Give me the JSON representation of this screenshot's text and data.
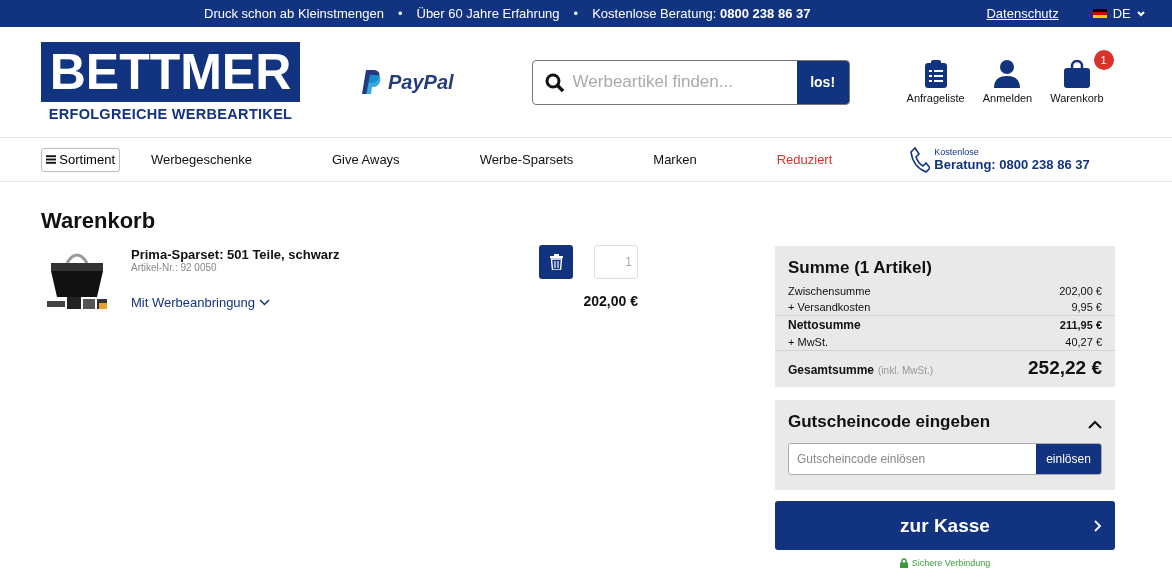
{
  "top_bar": {
    "items": [
      "Druck schon ab Kleinstmengen",
      "Über 60 Jahre Erfahrung",
      "Kostenlose Beratung: **0800 238 86 37**"
    ],
    "separator": "•",
    "link": "Datenschutz",
    "language": "DE"
  },
  "header": {
    "logo": {
      "name": "BETTMER",
      "tagline": "ERFOLGREICHE WERBEARTIKEL"
    },
    "payment": "PayPal",
    "search": {
      "placeholder": "Werbeartikel finden...",
      "button": "los!"
    },
    "actions": [
      {
        "kind": "list",
        "label": "Anfrageliste"
      },
      {
        "kind": "user",
        "label": "Anmelden"
      },
      {
        "kind": "cart",
        "label": "Warenkorb",
        "badge": "1"
      }
    ]
  },
  "nav": {
    "menu_button": "Sortiment",
    "items": [
      {
        "label": "Werbegeschenke",
        "kind": "normal"
      },
      {
        "label": "Give Aways",
        "kind": "normal"
      },
      {
        "label": "Werbe-Sparsets",
        "kind": "normal"
      },
      {
        "label": "Marken",
        "kind": "normal"
      },
      {
        "label": "Reduziert",
        "kind": "sale"
      }
    ],
    "phone": {
      "caption": "Kostenlose",
      "text": "Beratung: 0800 238 86 37"
    }
  },
  "cart": {
    "title": "Warenkorb",
    "items": [
      {
        "name": "Prima-Sparset: 501 Teile, schwarz",
        "article": "Artikel-Nr.: 92 0050",
        "option": "Mit Werbeanbringung",
        "quantity": "1",
        "price": "202,00 €"
      }
    ]
  },
  "summary": {
    "title": "Summe (1 Artikel)",
    "rows": [
      {
        "kind": "normal",
        "label": "Zwischensumme",
        "value": "202,00 €"
      },
      {
        "kind": "normal",
        "label": "+ Versandkosten",
        "value": "9,95 €"
      },
      {
        "kind": "bold",
        "label": "Nettosumme",
        "value": "211,95 €"
      },
      {
        "kind": "normal",
        "label": "+ MwSt.",
        "value": "40,27 €"
      },
      {
        "kind": "total",
        "label": "Gesamtsumme",
        "note": "(inkl. MwSt.)",
        "value": "252,22 €"
      }
    ]
  },
  "voucher": {
    "title": "Gutscheincode eingeben",
    "expanded": true,
    "placeholder": "Gutscheincode einlösen",
    "button": "einlösen"
  },
  "checkout": {
    "button": "zur Kasse",
    "secure": "Sichere Verbindung"
  }
}
